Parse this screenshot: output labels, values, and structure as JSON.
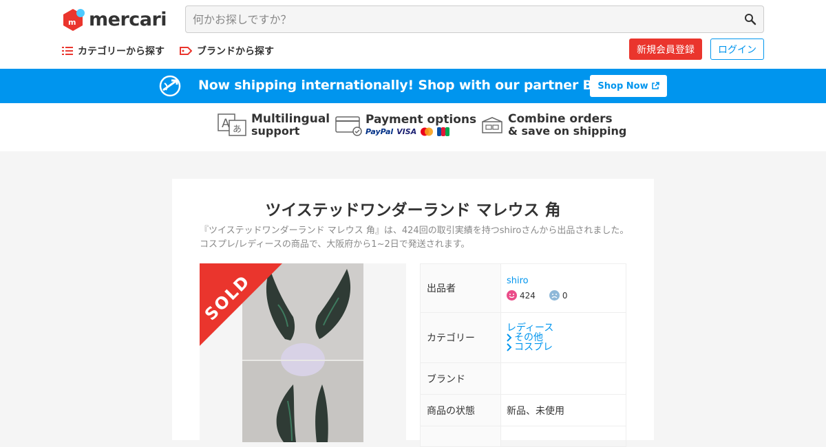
{
  "header": {
    "logo_text": "mercari",
    "search_placeholder": "何かお探しですか？",
    "nav_category": "カテゴリーから探す",
    "nav_brand": "ブランドから探す",
    "signup_label": "新規会員登録",
    "login_label": "ログイン"
  },
  "banner": {
    "text": "Now shipping internationally! Shop with our partner Buyee!",
    "button_label": "Shop Now",
    "bg_color": "#0095ee"
  },
  "features": [
    {
      "title": "Multilingual",
      "sub": "support"
    },
    {
      "title": "Payment options",
      "pay_methods": [
        "PayPal",
        "VISA"
      ]
    },
    {
      "title": "Combine orders",
      "sub": "& save on shipping"
    }
  ],
  "item": {
    "title": "ツイステッドワンダーランド マレウス 角",
    "description": "『ツイステッドワンダーランド マレウス 角』は、424回の取引実績を持つshiroさんから出品されました。コスプレ/レディースの商品で、大阪府から1~2日で発送されます。",
    "sold_label": "SOLD",
    "details": {
      "seller_label": "出品者",
      "seller_name": "shiro",
      "good_count": "424",
      "bad_count": "0",
      "category_label": "カテゴリー",
      "category_path": [
        "レディース",
        "その他",
        "コスプレ"
      ],
      "brand_label": "ブランド",
      "brand_value": "",
      "condition_label": "商品の状態",
      "condition_value": "新品、未使用"
    }
  },
  "colors": {
    "accent_red": "#ea352d",
    "link_blue": "#0095ee"
  }
}
